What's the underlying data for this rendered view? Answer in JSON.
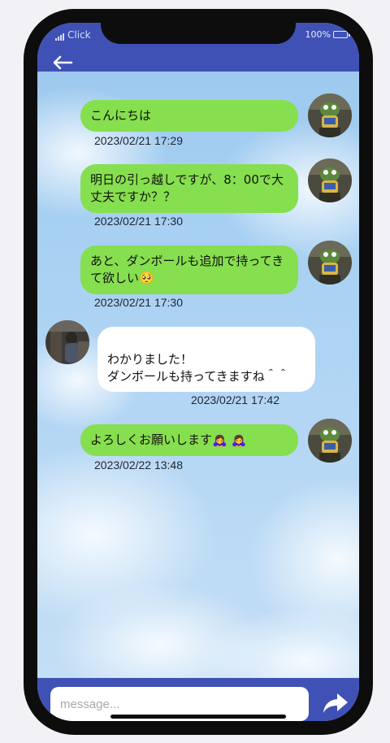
{
  "status_bar": {
    "carrier": "Click",
    "battery": "100%"
  },
  "header": {
    "back_icon": "arrow-left-icon"
  },
  "messages": [
    {
      "side": "sent",
      "text": "こんにちは",
      "time": "2023/02/21 17:29"
    },
    {
      "side": "sent",
      "text": "明日の引っ越しですが、8：00で大丈夫ですか？？",
      "time": "2023/02/21 17:30"
    },
    {
      "side": "sent",
      "text": "あと、ダンボールも追加で持ってきて欲しい🥺",
      "time": "2023/02/21 17:30"
    },
    {
      "side": "received",
      "text": "わかりました！\nダンボールも持ってきますね＾＾",
      "time": "2023/02/21 17:42"
    },
    {
      "side": "sent",
      "text": "よろしくお願いします🙇‍♀️ 🙇‍♀️",
      "time": "2023/02/22 13:48"
    }
  ],
  "composer": {
    "placeholder": "message...",
    "send_icon": "share-arrow-icon"
  },
  "colors": {
    "header": "#3f51b5",
    "sent_bubble": "#86df4e",
    "received_bubble": "#ffffff"
  }
}
